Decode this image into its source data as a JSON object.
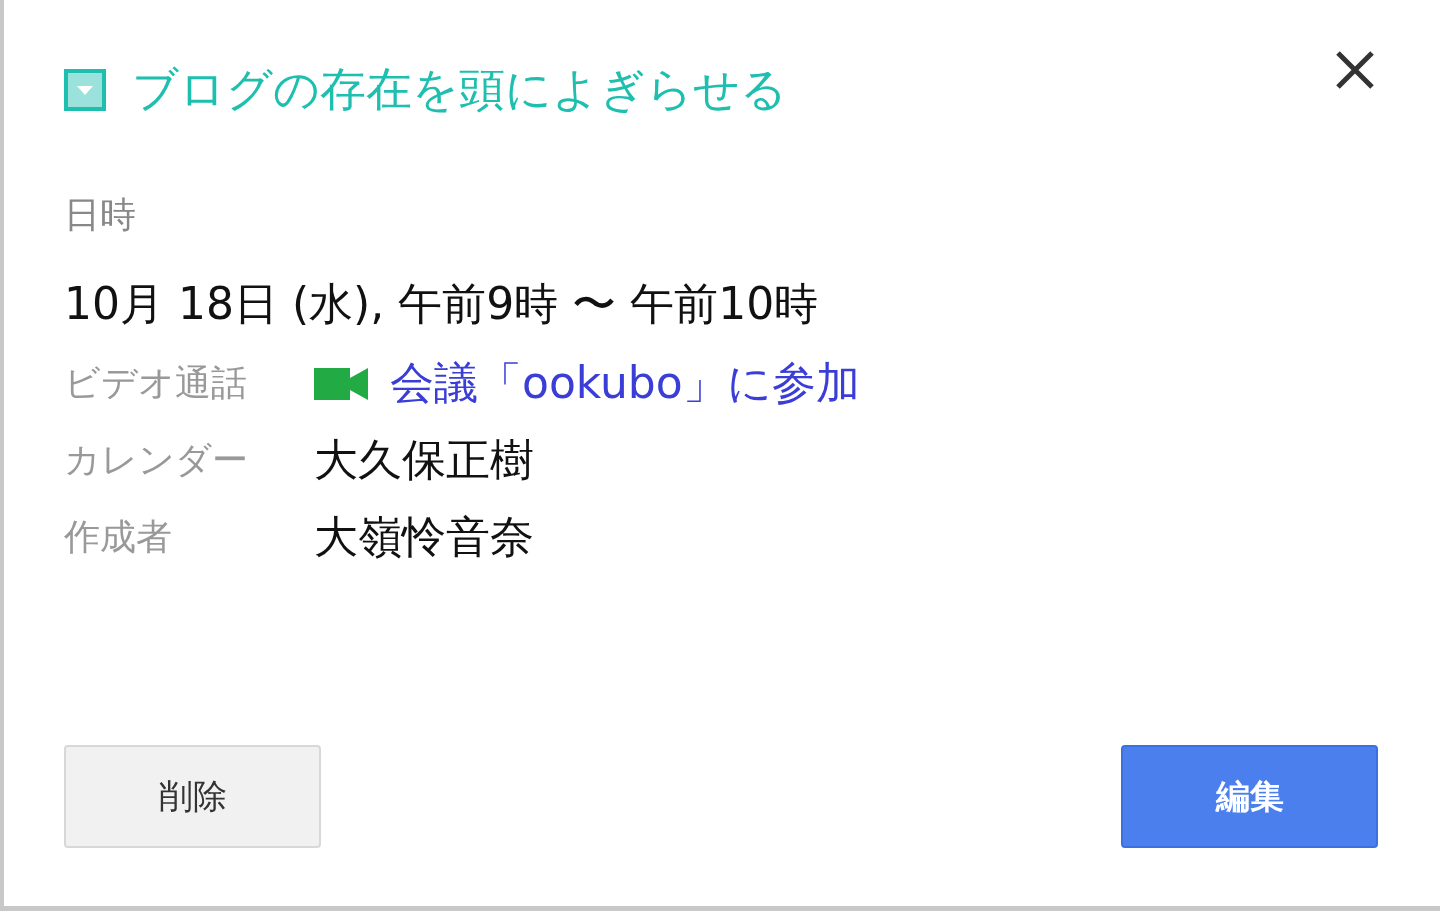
{
  "event": {
    "title": "ブログの存在を頭によぎらせる",
    "color": "#1fbfb0"
  },
  "date_label": "日時",
  "date_value": "10月 18日 (水), 午前9時 〜 午前10時",
  "details": [
    {
      "kind": "link",
      "label": "ビデオ通話",
      "value": "会議「ookubo」に参加"
    },
    {
      "kind": "text",
      "label": "カレンダー",
      "value": "大久保正樹"
    },
    {
      "kind": "text",
      "label": "作成者",
      "value": "大嶺怜音奈"
    }
  ],
  "buttons": [
    {
      "kind": "secondary",
      "label": "削除"
    },
    {
      "kind": "primary",
      "label": "編集"
    }
  ]
}
